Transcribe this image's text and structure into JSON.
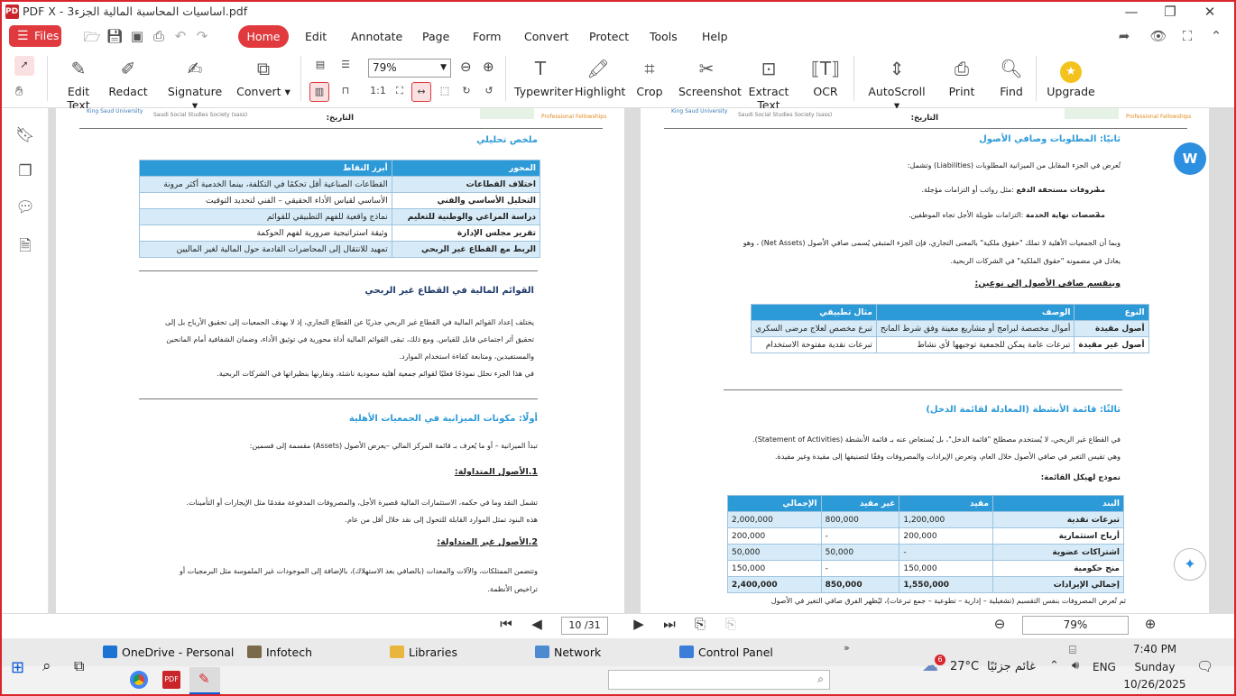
{
  "window": {
    "title": "PDF X - اساسيات المحاسبة المالية الجزء3.pdf",
    "app_badge": "PDF"
  },
  "menu": {
    "files": "Files",
    "home": "Home",
    "items": [
      "Edit",
      "Annotate",
      "Page",
      "Form",
      "Convert",
      "Protect",
      "Tools",
      "Help"
    ]
  },
  "toolbar": {
    "edit_text": "Edit Text",
    "redact": "Redact",
    "signature": "Signature",
    "convert": "Convert",
    "zoom": "79%",
    "typewriter": "Typewriter",
    "highlight": "Highlight",
    "crop": "Crop",
    "screenshot": "Screenshot",
    "extract_text": "Extract Text",
    "ocr": "OCR",
    "autoscroll": "AutoScroll",
    "print": "Print",
    "find": "Find",
    "upgrade": "Upgrade"
  },
  "left_page": {
    "logo_left": "King Saud University",
    "logo_sub": "Saudi Social Studies Society (sass)",
    "logo_right": "Professional Fellowships",
    "date_label": "التاريخ:",
    "summary_title": "ملخص تحليلي",
    "table_headers": [
      "المحور",
      "أبرز النقاط"
    ],
    "table_rows": [
      [
        "اختلاف القطاعات",
        "القطاعات الصناعية أقل تحكمًا في التكلفة، بينما الخدمية أكثر مرونة"
      ],
      [
        "التحليل الأساسي والفني",
        "الأساسي لقياس الأداء الحقيقي – الفني لتحديد التوقيت"
      ],
      [
        "دراسة المراعي والوطنية للتعليم",
        "نماذج واقعية للفهم التطبيقي للقوائم"
      ],
      [
        "تقرير مجلس الإدارة",
        "وثيقة استراتيجية ضرورية لفهم الحوكمة"
      ],
      [
        "الربط مع القطاع غير الربحي",
        "تمهيد للانتقال إلى المحاضرات القادمة حول المالية لغير الماليين"
      ]
    ],
    "section1_title": "القوائم المالية في القطاع غير الربحي",
    "section1_p1": "يختلف إعداد القوائم المالية في القطاع غير الربحي جذريًا عن القطاع التجاري، إذ لا يهدف الجمعيات إلى تحقيق الأرباح بل إلى",
    "section1_p2": "تحقيق أثر اجتماعي قابل للقياس. ومع ذلك، تبقى القوائم المالية أداة محورية في توثيق الأداء، وضمان الشفافية أمام المانحين",
    "section1_p3": "والمستفيدين، ومتابعة كفاءة استخدام الموارد.",
    "section1_p4": "في هذا الجزء نحلل نموذجًا فعليًا لقوائم جمعية أهلية سعودية ناشئة، ونقارنها بنظيراتها في الشركات الربحية.",
    "section2_title": "أولًا: مكونات الميزانية في الجمعيات الأهلية",
    "section2_intro": "تبدأ الميزانية – أو ما يُعرف بـ قائمة المركز المالي –يعرض الأصول (Assets) مقسمة إلى قسمين:",
    "sub1_title": "1.الأصول المتداولة:",
    "sub1_p1": "تشمل النقد وما في حكمه، الاستثمارات المالية قصيرة الأجل، والمصروفات المدفوعة مقدمًا مثل الإيجارات أو التأمينات.",
    "sub1_p2": "هذه البنود تمثل الموارد القابلة للتحول إلى نقد خلال أقل من عام.",
    "sub2_title": "2.الأصول غير المتداولة:",
    "sub2_p1": "وتتضمن الممتلكات، والآلات والمعدات (بالصافي بعد الاستهلاك)، بالإضافة إلى الموجودات غير الملموسة مثل البرمجيات أو",
    "sub2_p2": "تراخيص الأنظمة."
  },
  "right_page": {
    "logo_left": "King Saud University",
    "logo_sub": "Saudi Social Studies Society (sass)",
    "logo_right": "Professional Fellowships",
    "date_label": "التاريخ:",
    "section2_title": "ثانيًا: المطلوبات وصافي الأصول",
    "intro": "تُعرض في الجزء المقابل من الميزانية المطلوبات (Liabilities) وتشمل:",
    "li1_num": "1.",
    "li1_bold": "مصروفات مستحقة الدفع",
    "li1_text": "مثل رواتب أو التزامات مؤجلة.",
    "li2_num": "2.",
    "li2_bold": "مخصصات نهاية الخدمة",
    "li2_text": "التزامات طويلة الأجل تجاه الموظفين.",
    "p1": "وبما أن الجمعيات الأهلية لا تملك \"حقوق ملكية\" بالمعنى التجاري، فإن الجزء المتبقي يُسمى صافي الأصول (Net Assets) ، وهو",
    "p2": "يعادل في مضمونه \"حقوق الملكية\" في الشركات الربحية.",
    "split_title": "وينقسم صافي الأصول إلى نوعين:",
    "t1_headers": [
      "النوع",
      "الوصف",
      "مثال تطبيقي"
    ],
    "t1_rows": [
      [
        "أصول مقيدة",
        "أموال مخصصة لبرامج أو مشاريع معينة وفق شرط المانح",
        "تبرع مخصص لعلاج مرضى السكري"
      ],
      [
        "أصول غير مقيدة",
        "تبرعات عامة يمكن للجمعية توجيهها لأي نشاط",
        "تبرعات نقدية مفتوحة الاستخدام"
      ]
    ],
    "section3_title": "ثالثًا: قائمة الأنشطة (المعادلة لقائمة الدخل)",
    "s3_p1": "في القطاع غير الربحي، لا يُستخدم مصطلح \"قائمة الدخل\"، بل يُستعاض عنه بـ قائمة الأنشطة (Statement of Activities).",
    "s3_p2": "وهي تقيس التغير في صافي الأصول خلال العام، وتعرض الإيرادات والمصروفات وفقًا لتصنيفها إلى مقيدة وغير مقيدة.",
    "s3_model": "نموذج لهيكل القائمة:",
    "t2_headers": [
      "البند",
      "مقيد",
      "غير مقيد",
      "الإجمالي"
    ],
    "t2_rows": [
      [
        "تبرعات نقدية",
        "1,200,000",
        "800,000",
        "2,000,000"
      ],
      [
        "أرباح استثمارية",
        "200,000",
        "-",
        "200,000"
      ],
      [
        "اشتراكات عضوية",
        "-",
        "50,000",
        "50,000"
      ],
      [
        "منح حكومية",
        "150,000",
        "-",
        "150,000"
      ],
      [
        "إجمالي الإيرادات",
        "1,550,000",
        "850,000",
        "2,400,000"
      ]
    ],
    "s3_tail": "ثم تُعرض المصروفات بنفس التقسيم (تشغيلية – إدارية – تطوعية – جمع تبرعات)، ليُظهر الفرق صافي التغير في الأصول"
  },
  "statusbar": {
    "page": "10 /31",
    "zoom": "79%"
  },
  "taskbar": {
    "pinned": [
      "OneDrive - Personal",
      "Infotech",
      "Libraries",
      "Network",
      "Control Panel"
    ],
    "weather_temp": "27°C",
    "weather_text": "غائم جزئيًا",
    "weather_badge": "6",
    "lang": "ENG",
    "time": "7:40 PM",
    "day": "Sunday",
    "date": "10/26/2025"
  }
}
